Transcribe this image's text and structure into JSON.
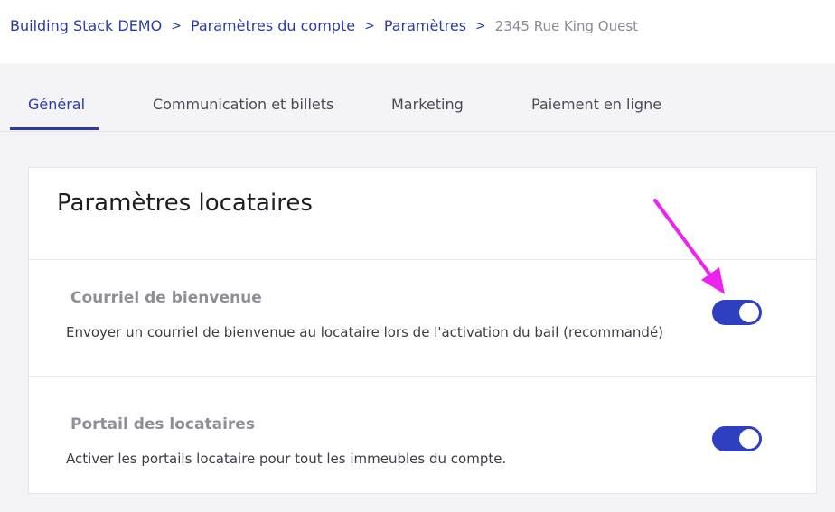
{
  "breadcrumb": {
    "items": [
      "Building Stack DEMO",
      "Paramètres du compte",
      "Paramètres"
    ],
    "current": "2345 Rue King Ouest",
    "separator": ">"
  },
  "tabs": [
    {
      "label": "Général",
      "active": true
    },
    {
      "label": "Communication et billets",
      "active": false
    },
    {
      "label": "Marketing",
      "active": false
    },
    {
      "label": "Paiement en ligne",
      "active": false
    }
  ],
  "card": {
    "title": "Paramètres locataires",
    "settings": [
      {
        "title": "Courriel de bienvenue",
        "description": "Envoyer un courriel de bienvenue au locataire lors de l'activation du bail (recommandé)",
        "enabled": true
      },
      {
        "title": "Portail des locataires",
        "description": "Activer les portails locataire pour tout les immeubles du compte.",
        "enabled": true
      }
    ]
  },
  "colors": {
    "accent": "#2a3aa8",
    "toggle_on": "#2e3fc2",
    "annotation": "#ee22ee",
    "page_bg": "#f4f4f7"
  },
  "icons": {
    "annotation": "arrow-annotation-icon",
    "toggle_knob": "toggle-knob"
  }
}
